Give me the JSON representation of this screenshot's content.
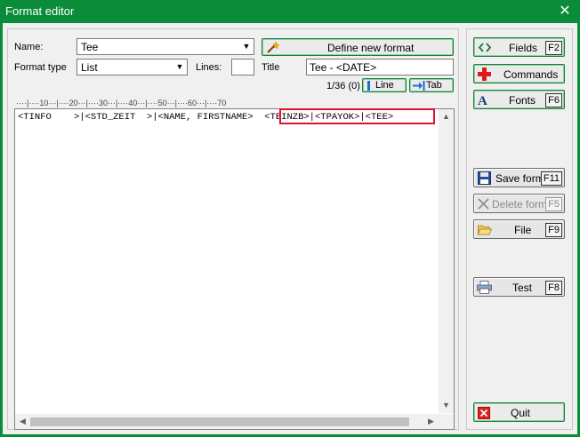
{
  "window": {
    "title": "Format editor",
    "close_glyph": "✕"
  },
  "form": {
    "name_label": "Name:",
    "name_value": "Tee",
    "format_type_label": "Format type",
    "format_type_value": "List",
    "lines_label": "Lines:",
    "lines_value": "",
    "title_label": "Title",
    "title_value": "Tee - <DATE>",
    "define_new_format_label": "Define new format",
    "counter": "1/36 (0)",
    "line_button_label": "Line",
    "tab_button_label": "Tab"
  },
  "ruler": {
    "text": "····|····10···|····20···|····30···|····40···|····50···|····60···|····70"
  },
  "editor": {
    "line1_part1": "<TINFO    >|<STD_ZEIT  >|<NAME, FIRSTNAME>",
    "line1_highlight": "<TEINZB>|<TPAYOK>|<TEE>",
    "scroll_up": "▲",
    "scroll_down": "▼",
    "scroll_left": "◀",
    "scroll_right": "▶"
  },
  "side_buttons": {
    "fields": {
      "label": "Fields",
      "key": "F2"
    },
    "commands": {
      "label": "Commands"
    },
    "fonts": {
      "label": "Fonts",
      "key": "F6"
    },
    "save_format": {
      "label": "Save format",
      "key": "F11"
    },
    "delete_format": {
      "label": "Delete forma",
      "key": "F5"
    },
    "file": {
      "label": "File",
      "key": "F9"
    },
    "test": {
      "label": "Test",
      "key": "F8"
    },
    "quit": {
      "label": "Quit"
    }
  },
  "colors": {
    "title_bar": "#0b8c3a",
    "highlight_border": "#e0112b",
    "client_bg": "#f0f0f0"
  }
}
